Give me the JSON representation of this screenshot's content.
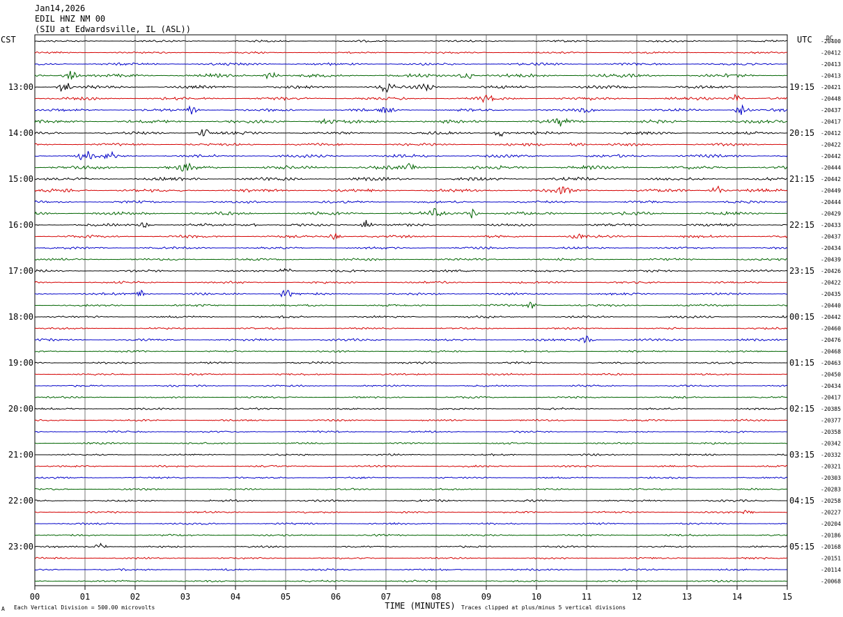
{
  "header": {
    "date": "Jan14,2026",
    "station": "EDIL HNZ NM 00",
    "location": "(SIU at Edwardsville, IL  (ASL))"
  },
  "left_zone": "CST",
  "right_zone": "UTC",
  "dc_label": "DC",
  "footer": {
    "scale": "Each Vertical Division =  500.00 microvolts",
    "clip": "Traces clipped at plus/minus 5 vertical divisions",
    "mark": "A"
  },
  "chart_data": {
    "type": "line",
    "xlabel": "TIME (MINUTES)",
    "xlim": [
      0,
      15
    ],
    "x_ticks": [
      "00",
      "01",
      "02",
      "03",
      "04",
      "05",
      "06",
      "07",
      "08",
      "09",
      "10",
      "11",
      "12",
      "13",
      "14",
      "15"
    ],
    "trace_colors": [
      "#000000",
      "#d40000",
      "#0000c8",
      "#006400"
    ],
    "left_hour_labels": [
      "13:00",
      "14:00",
      "15:00",
      "16:00",
      "17:00",
      "18:00",
      "19:00",
      "20:00",
      "21:00",
      "22:00",
      "23:00"
    ],
    "right_hour_labels": [
      "19:15",
      "20:15",
      "21:15",
      "22:15",
      "23:15",
      "00:15",
      "01:15",
      "02:15",
      "03:15",
      "04:15",
      "05:15"
    ],
    "hour_label_first_trace": 4,
    "traces_per_hour": 4,
    "dc_offsets": [
      "-20400",
      "-20412",
      "-20413",
      "-20413",
      "-20421",
      "-20448",
      "-20437",
      "-20417",
      "-20412",
      "-20422",
      "-20442",
      "-20444",
      "-20442",
      "-20449",
      "-20444",
      "-20429",
      "-20433",
      "-20437",
      "-20434",
      "-20439",
      "-20426",
      "-20422",
      "-20435",
      "-20440",
      "-20442",
      "-20460",
      "-20476",
      "-20468",
      "-20463",
      "-20450",
      "-20434",
      "-20417",
      "-20385",
      "-20377",
      "-20358",
      "-20342",
      "-20332",
      "-20321",
      "-20303",
      "-20283",
      "-20258",
      "-20227",
      "-20204",
      "-20186",
      "-20168",
      "-20151",
      "-20114",
      "-20068"
    ],
    "amplitude_levels": [
      1.0,
      1.0,
      1.4,
      1.8,
      1.6,
      1.6,
      1.4,
      1.8,
      1.5,
      1.4,
      1.6,
      2.0,
      1.8,
      1.8,
      1.3,
      1.8,
      1.4,
      1.4,
      1.2,
      1.2,
      1.2,
      1.2,
      1.2,
      1.2,
      1.2,
      1.0,
      1.2,
      1.0,
      1.1,
      1.0,
      1.0,
      1.0,
      1.0,
      1.0,
      1.0,
      1.0,
      1.0,
      1.0,
      1.0,
      1.0,
      1.1,
      1.0,
      1.0,
      1.0,
      1.0,
      1.0,
      1.0,
      1.0
    ],
    "events": [
      {
        "trace": 3,
        "minute": 0.7,
        "amp": 6
      },
      {
        "trace": 3,
        "minute": 4.7,
        "amp": 4
      },
      {
        "trace": 3,
        "minute": 8.6,
        "amp": 5
      },
      {
        "trace": 4,
        "minute": 0.6,
        "amp": 6
      },
      {
        "trace": 4,
        "minute": 7.0,
        "amp": 5
      },
      {
        "trace": 4,
        "minute": 7.8,
        "amp": 4
      },
      {
        "trace": 5,
        "minute": 14.0,
        "amp": 5
      },
      {
        "trace": 5,
        "minute": 9.0,
        "amp": 3
      },
      {
        "trace": 6,
        "minute": 3.1,
        "amp": 4
      },
      {
        "trace": 6,
        "minute": 7.0,
        "amp": 4
      },
      {
        "trace": 6,
        "minute": 14.1,
        "amp": 6
      },
      {
        "trace": 6,
        "minute": 11.0,
        "amp": 3
      },
      {
        "trace": 7,
        "minute": 10.5,
        "amp": 4
      },
      {
        "trace": 7,
        "minute": 5.8,
        "amp": 3
      },
      {
        "trace": 8,
        "minute": 3.4,
        "amp": 5
      },
      {
        "trace": 8,
        "minute": 9.3,
        "amp": 4
      },
      {
        "trace": 9,
        "minute": 10.8,
        "amp": 3
      },
      {
        "trace": 10,
        "minute": 1.0,
        "amp": 5
      },
      {
        "trace": 10,
        "minute": 1.5,
        "amp": 4
      },
      {
        "trace": 11,
        "minute": 3.0,
        "amp": 3
      },
      {
        "trace": 11,
        "minute": 7.5,
        "amp": 3
      },
      {
        "trace": 13,
        "minute": 10.5,
        "amp": 5
      },
      {
        "trace": 13,
        "minute": 13.6,
        "amp": 4
      },
      {
        "trace": 15,
        "minute": 8.0,
        "amp": 5
      },
      {
        "trace": 15,
        "minute": 8.7,
        "amp": 5
      },
      {
        "trace": 16,
        "minute": 6.6,
        "amp": 6
      },
      {
        "trace": 16,
        "minute": 4.3,
        "amp": 3
      },
      {
        "trace": 16,
        "minute": 2.2,
        "amp": 3
      },
      {
        "trace": 17,
        "minute": 6.0,
        "amp": 3
      },
      {
        "trace": 17,
        "minute": 10.8,
        "amp": 3
      },
      {
        "trace": 20,
        "minute": 5.0,
        "amp": 3
      },
      {
        "trace": 22,
        "minute": 2.1,
        "amp": 4
      },
      {
        "trace": 22,
        "minute": 5.0,
        "amp": 4
      },
      {
        "trace": 23,
        "minute": 9.9,
        "amp": 3
      },
      {
        "trace": 26,
        "minute": 11.0,
        "amp": 4
      },
      {
        "trace": 44,
        "minute": 1.3,
        "amp": 3
      },
      {
        "trace": 41,
        "minute": 14.2,
        "amp": 3
      }
    ]
  }
}
